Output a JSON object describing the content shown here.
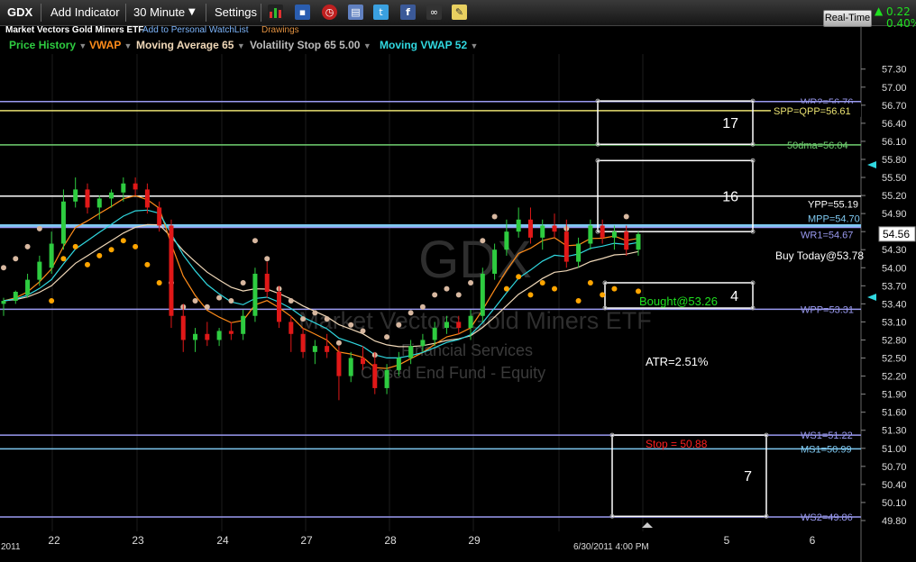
{
  "toolbar": {
    "symbol": "GDX",
    "add_indicator": "Add Indicator",
    "interval": "30 Minute",
    "settings": "Settings",
    "real_time": "Real-Time",
    "change": "0.22",
    "change_pct": "0.40%",
    "icons": [
      "bar-chart-icon",
      "save-icon",
      "clock-icon",
      "print-icon",
      "twitter-icon",
      "facebook-icon",
      "binoculars-icon",
      "note-icon"
    ]
  },
  "subheader": {
    "name": "Market Vectors Gold Miners ETF",
    "watchlist": "Add to Personal WatchList",
    "drawings": "Drawings"
  },
  "legend": [
    {
      "label": "Price History",
      "color": "#2ecc40"
    },
    {
      "label": "VWAP",
      "color": "#ff8c1a"
    },
    {
      "label": "Moving Average 65",
      "color": "#f0d8b8"
    },
    {
      "label": "Volatility Stop 65 5.00",
      "color": "#bbbbbb"
    },
    {
      "label": "Moving VWAP 52",
      "color": "#30d8e0"
    }
  ],
  "watermark": {
    "symbol": "GDX",
    "name": "Market Vectors Gold Miners ETF",
    "sector": "Financial Services",
    "industry": "Closed End Fund - Equity"
  },
  "chart_data": {
    "type": "candlestick",
    "symbol": "GDX",
    "interval": "30 Minute",
    "ylim": [
      49.62,
      57.55
    ],
    "y_ticks": [
      57.3,
      57.0,
      56.7,
      56.4,
      56.1,
      55.8,
      55.5,
      55.2,
      54.9,
      54.6,
      54.3,
      54.0,
      53.7,
      53.4,
      53.1,
      52.8,
      52.5,
      52.2,
      51.9,
      51.6,
      51.3,
      51.0,
      50.7,
      50.4,
      50.1,
      49.8
    ],
    "y_tick_labels": [
      "57.30",
      "57.00",
      "56.70",
      "56.40",
      "56.10",
      "55.80",
      "55.50",
      "55.20",
      "54.90",
      "54.60",
      "54.30",
      "54.00",
      "53.70",
      "53.40",
      "53.10",
      "52.80",
      "52.50",
      "52.20",
      "51.90",
      "51.60",
      "51.30",
      "51.00",
      "50.70",
      "50.40",
      "50.10",
      "49.80"
    ],
    "x_labels": [
      "2011",
      "22",
      "23",
      "24",
      "27",
      "28",
      "29",
      "6/30/2011 4:00 PM",
      "5",
      "6"
    ],
    "last_price": "54.56",
    "candles": [
      [
        53.4,
        53.5,
        53.2,
        53.45
      ],
      [
        53.45,
        53.62,
        53.4,
        53.6
      ],
      [
        53.55,
        53.9,
        53.5,
        53.8
      ],
      [
        53.8,
        54.2,
        53.7,
        54.1
      ],
      [
        54.0,
        54.6,
        53.9,
        54.4
      ],
      [
        54.4,
        55.3,
        54.3,
        55.1
      ],
      [
        55.1,
        55.5,
        55.0,
        55.3
      ],
      [
        55.3,
        55.4,
        54.9,
        55.0
      ],
      [
        55.0,
        55.2,
        54.8,
        55.15
      ],
      [
        55.15,
        55.3,
        55.0,
        55.25
      ],
      [
        55.25,
        55.5,
        55.1,
        55.4
      ],
      [
        55.4,
        55.5,
        55.2,
        55.3
      ],
      [
        55.3,
        55.4,
        54.9,
        55.0
      ],
      [
        55.0,
        55.1,
        54.6,
        54.7
      ],
      [
        54.7,
        54.8,
        53.0,
        53.2
      ],
      [
        53.2,
        53.4,
        52.6,
        52.8
      ],
      [
        52.8,
        53.0,
        52.6,
        52.9
      ],
      [
        52.9,
        53.1,
        52.7,
        52.8
      ],
      [
        52.8,
        53.0,
        52.7,
        52.95
      ],
      [
        52.95,
        53.1,
        52.8,
        52.9
      ],
      [
        52.9,
        53.3,
        52.8,
        53.2
      ],
      [
        53.2,
        54.0,
        53.1,
        53.9
      ],
      [
        53.9,
        54.1,
        53.5,
        53.6
      ],
      [
        53.6,
        53.7,
        53.0,
        53.1
      ],
      [
        53.1,
        53.2,
        52.6,
        52.9
      ],
      [
        52.9,
        53.0,
        52.5,
        52.6
      ],
      [
        52.6,
        52.8,
        52.4,
        52.7
      ],
      [
        52.7,
        52.9,
        52.5,
        52.6
      ],
      [
        52.6,
        52.7,
        51.8,
        52.2
      ],
      [
        52.2,
        52.6,
        52.1,
        52.5
      ],
      [
        52.5,
        52.7,
        52.3,
        52.4
      ],
      [
        52.4,
        52.6,
        51.9,
        52.0
      ],
      [
        52.0,
        52.4,
        51.9,
        52.3
      ],
      [
        52.3,
        52.6,
        52.2,
        52.5
      ],
      [
        52.5,
        52.8,
        52.4,
        52.7
      ],
      [
        52.7,
        52.9,
        52.6,
        52.8
      ],
      [
        52.8,
        53.1,
        52.7,
        53.0
      ],
      [
        53.0,
        53.2,
        52.9,
        53.1
      ],
      [
        53.1,
        53.2,
        52.9,
        53.0
      ],
      [
        53.0,
        53.3,
        52.8,
        53.2
      ],
      [
        53.2,
        54.0,
        53.1,
        53.9
      ],
      [
        53.9,
        54.4,
        53.8,
        54.3
      ],
      [
        54.3,
        54.8,
        54.2,
        54.6
      ],
      [
        54.6,
        55.0,
        54.5,
        54.8
      ],
      [
        54.8,
        55.0,
        54.4,
        54.5
      ],
      [
        54.5,
        54.8,
        54.3,
        54.7
      ],
      [
        54.7,
        54.9,
        54.5,
        54.6
      ],
      [
        54.6,
        54.8,
        54.0,
        54.1
      ],
      [
        54.1,
        54.5,
        54.0,
        54.4
      ],
      [
        54.4,
        54.8,
        54.3,
        54.7
      ],
      [
        54.7,
        54.8,
        54.4,
        54.5
      ],
      [
        54.5,
        54.7,
        54.3,
        54.6
      ],
      [
        54.6,
        54.7,
        54.2,
        54.3
      ],
      [
        54.3,
        54.6,
        54.2,
        54.56
      ]
    ],
    "levels": [
      {
        "label": "WR2=56.76",
        "value": 56.76,
        "color": "#9a9af0"
      },
      {
        "label": "SPP=QPP=56.61",
        "value": 56.61,
        "color": "#e8e070"
      },
      {
        "label": "50dma=56.04",
        "value": 56.04,
        "color": "#70d070"
      },
      {
        "label": "YPP=55.19",
        "value": 55.19,
        "color": "#ffffff"
      },
      {
        "label": "MPP=54.70",
        "value": 54.7,
        "color": "#7ec8f0"
      },
      {
        "label": "WR1=54.67",
        "value": 54.67,
        "color": "#9a9af0"
      },
      {
        "label": "WPP=53.31",
        "value": 53.31,
        "color": "#9a9af0"
      },
      {
        "label": "WS1=51.22",
        "value": 51.22,
        "color": "#9a9af0"
      },
      {
        "label": "MS1=50.99",
        "value": 50.99,
        "color": "#7ec8f0"
      },
      {
        "label": "WS2=49.86",
        "value": 49.86,
        "color": "#9a9af0"
      }
    ],
    "annotations": [
      {
        "text": "Buy Today@53.78",
        "color": "#ffffff"
      },
      {
        "text": "Bought@53.26",
        "color": "#20e020"
      },
      {
        "text": "ATR=2.51%",
        "color": "#ffffff"
      },
      {
        "text": "Stop = 50.88",
        "color": "#ff2020"
      }
    ],
    "boxes": [
      "17",
      "16",
      "4",
      "7"
    ],
    "series_colors": {
      "up": "#2ecc40",
      "down": "#e01818",
      "vwap": "#ff8c1a",
      "ma65": "#f0d8b8",
      "vstop": "#d8b8a0",
      "mvwap": "#30d8e0"
    }
  }
}
